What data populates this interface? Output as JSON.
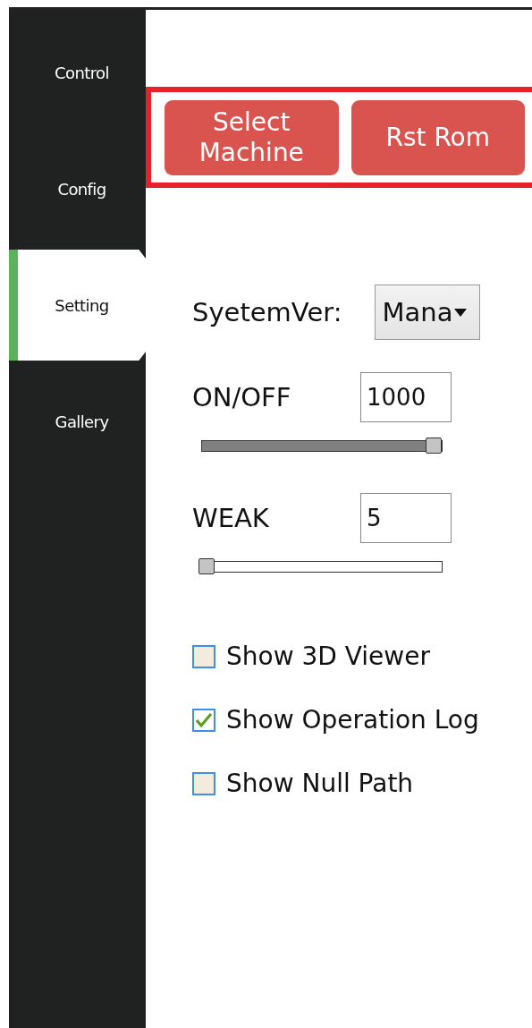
{
  "sidebar": {
    "tabs": [
      {
        "label": "Control",
        "selected": false
      },
      {
        "label": "Config",
        "selected": false
      },
      {
        "label": "Setting",
        "selected": true
      },
      {
        "label": "Gallery",
        "selected": false
      }
    ]
  },
  "toolbar": {
    "buttons": [
      "Select Machine",
      "Rst Rom"
    ]
  },
  "settings": {
    "system_version": {
      "label": "SyetemVer:",
      "value": "Mana"
    },
    "sliders": [
      {
        "label": "ON/OFF",
        "value": "1000",
        "level": 1
      },
      {
        "label": "WEAK",
        "value": "5",
        "level": 0
      }
    ],
    "checkboxes": [
      {
        "label": "Show 3D Viewer",
        "checked": false
      },
      {
        "label": "Show Operation Log",
        "checked": true
      },
      {
        "label": "Show Null Path",
        "checked": false
      }
    ]
  }
}
